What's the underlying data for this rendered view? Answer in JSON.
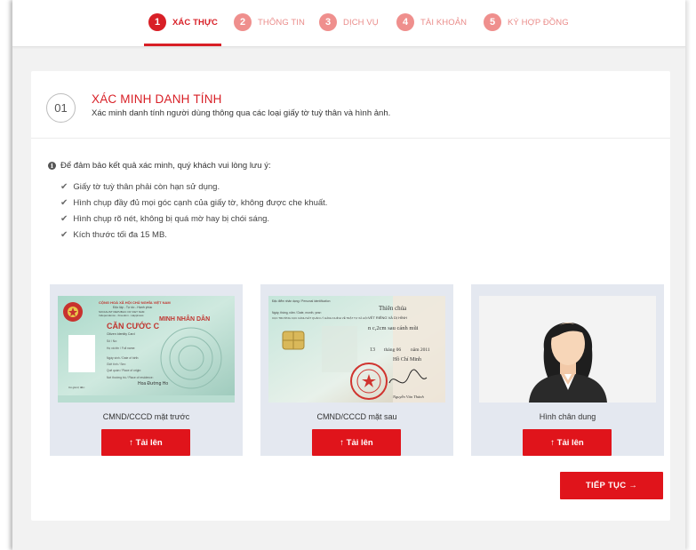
{
  "steps": [
    {
      "num": "1",
      "label": "XÁC THỰC",
      "state": "active"
    },
    {
      "num": "2",
      "label": "THÔNG TIN",
      "state": "inactive"
    },
    {
      "num": "3",
      "label": "DỊCH VỤ",
      "state": "inactive"
    },
    {
      "num": "4",
      "label": "TÀI KHOẢN",
      "state": "inactive"
    },
    {
      "num": "5",
      "label": "KÝ HỢP ĐỒNG",
      "state": "inactive"
    }
  ],
  "section": {
    "number": "01",
    "title": "XÁC MINH DANH TÍNH",
    "subtitle": "Xác minh danh tính người dùng thông qua các loại giấy tờ tuỳ thân và hình ảnh."
  },
  "notice": "Để đảm bảo kết quả xác minh, quý khách vui lòng lưu ý:",
  "requirements": [
    "Giấy tờ tuỳ thân phải còn hạn sử dụng.",
    "Hình chụp đầy đủ mọi góc cạnh của giấy tờ, không được che khuất.",
    "Hình chụp rõ nét, không bị quá mờ hay bị chói sáng.",
    "Kích thước tối đa 15 MB."
  ],
  "uploads": [
    {
      "label": "CMND/CCCD mặt trước",
      "button": "↑ Tải lên",
      "card_text": {
        "country": "CỘNG HOÀ XÃ HỘI CHỦ NGHĨA VIỆT NAM",
        "motto": "Độc lập - Tự do - Hạnh phúc",
        "country_en": "SOCIALIST REPUBLIC OF VIET NAM",
        "motto_en": "Independence - Freedom - Happiness",
        "title": "CĂN CƯỚC C",
        "title_en": "MINH NHÂN DÂN",
        "id_label": "Citizen Identity Card",
        "fields": [
          "Số / No:",
          "Họ và tên / Full name:",
          "Ngày sinh / Date of birth:",
          "Giới tính / Sex:",
          "Quê quán / Place of origin:",
          "Nơi thường trú / Place of residence:"
        ],
        "residence_value": "Hoa Đường Ho",
        "expiry": "Có giá trị đến:"
      }
    },
    {
      "label": "CMND/CCCD mặt sau",
      "button": "↑ Tải lên",
      "card_text": {
        "header": "Đặc điểm nhân dạng / Personal identification",
        "religion": "Thiên chúa",
        "marks_title": "VẾT RIÊNG VÀ DỊ HÌNH",
        "mark": "n c,2cm sau cánh mũi",
        "date_prefix": "13",
        "date_mid": "tháng 06",
        "date_suffix": "năm 2011",
        "place": "Hồ Chí Minh",
        "date_label": "Ngày, tháng, năm / Date, month, year:",
        "director": "CỤC TRƯỞNG CỤC CẢNH SÁT QUẢN LÝ HÀNH CHÍNH VỀ TRẬT TỰ XÃ HỘI",
        "signature": "Nguyễn Văn Thành"
      }
    },
    {
      "label": "Hình chân dung",
      "button": "↑ Tải lên"
    }
  ],
  "next_button": "TIẾP TỤC →",
  "colors": {
    "brand": "#e0141b",
    "brand_light": "#ef8f8d",
    "card_bg": "#e4e8f0"
  }
}
